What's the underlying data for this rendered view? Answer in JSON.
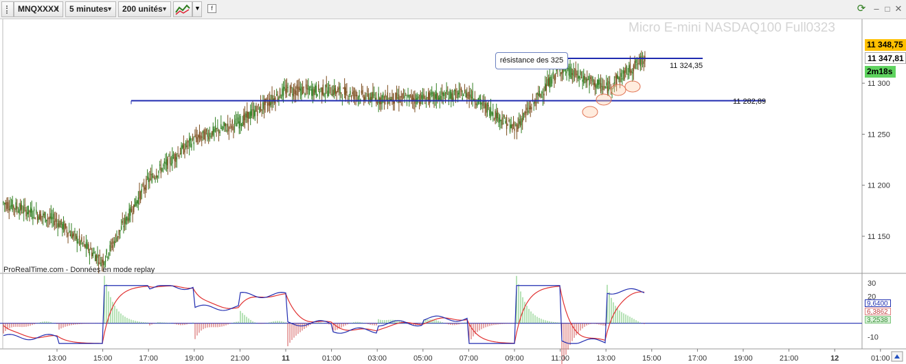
{
  "toolbar": {
    "symbol": "MNQXXXX",
    "timeframe": "5 minutes",
    "units": "200 unités"
  },
  "chart": {
    "instrument_title": "Micro E-mini NASDAQ100 Full0323",
    "source_note": "ProRealTime.com - Données en mode replay",
    "annotation": "résistance des 325",
    "resistance_label": "11 324,35",
    "support_label": "11 282,89",
    "last_price": "11 348,75",
    "close_price": "11 347,81",
    "countdown": "2m18s",
    "price_ticks": [
      "11 300",
      "11 250",
      "11 200",
      "11 150"
    ],
    "indicator_ticks": [
      "30",
      "20",
      "-10"
    ],
    "indicator_values": {
      "macd": "9,6400",
      "signal": "6,3862",
      "histogram": "3,2538"
    },
    "time_ticks": [
      "13:00",
      "15:00",
      "17:00",
      "19:00",
      "21:00",
      "11",
      "01:00",
      "03:00",
      "05:00",
      "07:00",
      "09:00",
      "11:00",
      "13:00",
      "15:00",
      "17:00",
      "19:00",
      "21:00",
      "12",
      "01:00"
    ],
    "colors": {
      "up_candle": "#2e7d1e",
      "level_line": "#1f2bb0",
      "macd_line": "#1f2bb0",
      "signal_line": "#e03030",
      "last_price_bg": "#ffc000",
      "countdown_bg": "#5fd35f"
    }
  },
  "chart_data": {
    "type": "line",
    "x": [
      "13:00",
      "15:00",
      "17:00",
      "19:00",
      "21:00",
      "11",
      "01:00",
      "03:00",
      "05:00",
      "07:00",
      "09:00",
      "11:00",
      "13:00",
      "15:00"
    ],
    "series": [
      {
        "values": [
          11165,
          11125,
          11205,
          11245,
          11262,
          11293,
          11293,
          11285,
          11285,
          11290,
          11255,
          11315,
          11295,
          11330
        ]
      }
    ],
    "levels": [
      11324.35,
      11282.89
    ],
    "ylim": [
      11115,
      11360
    ],
    "indicator": {
      "ylim": [
        -18,
        35
      ],
      "ticks": [
        30,
        20,
        -10
      ]
    }
  }
}
